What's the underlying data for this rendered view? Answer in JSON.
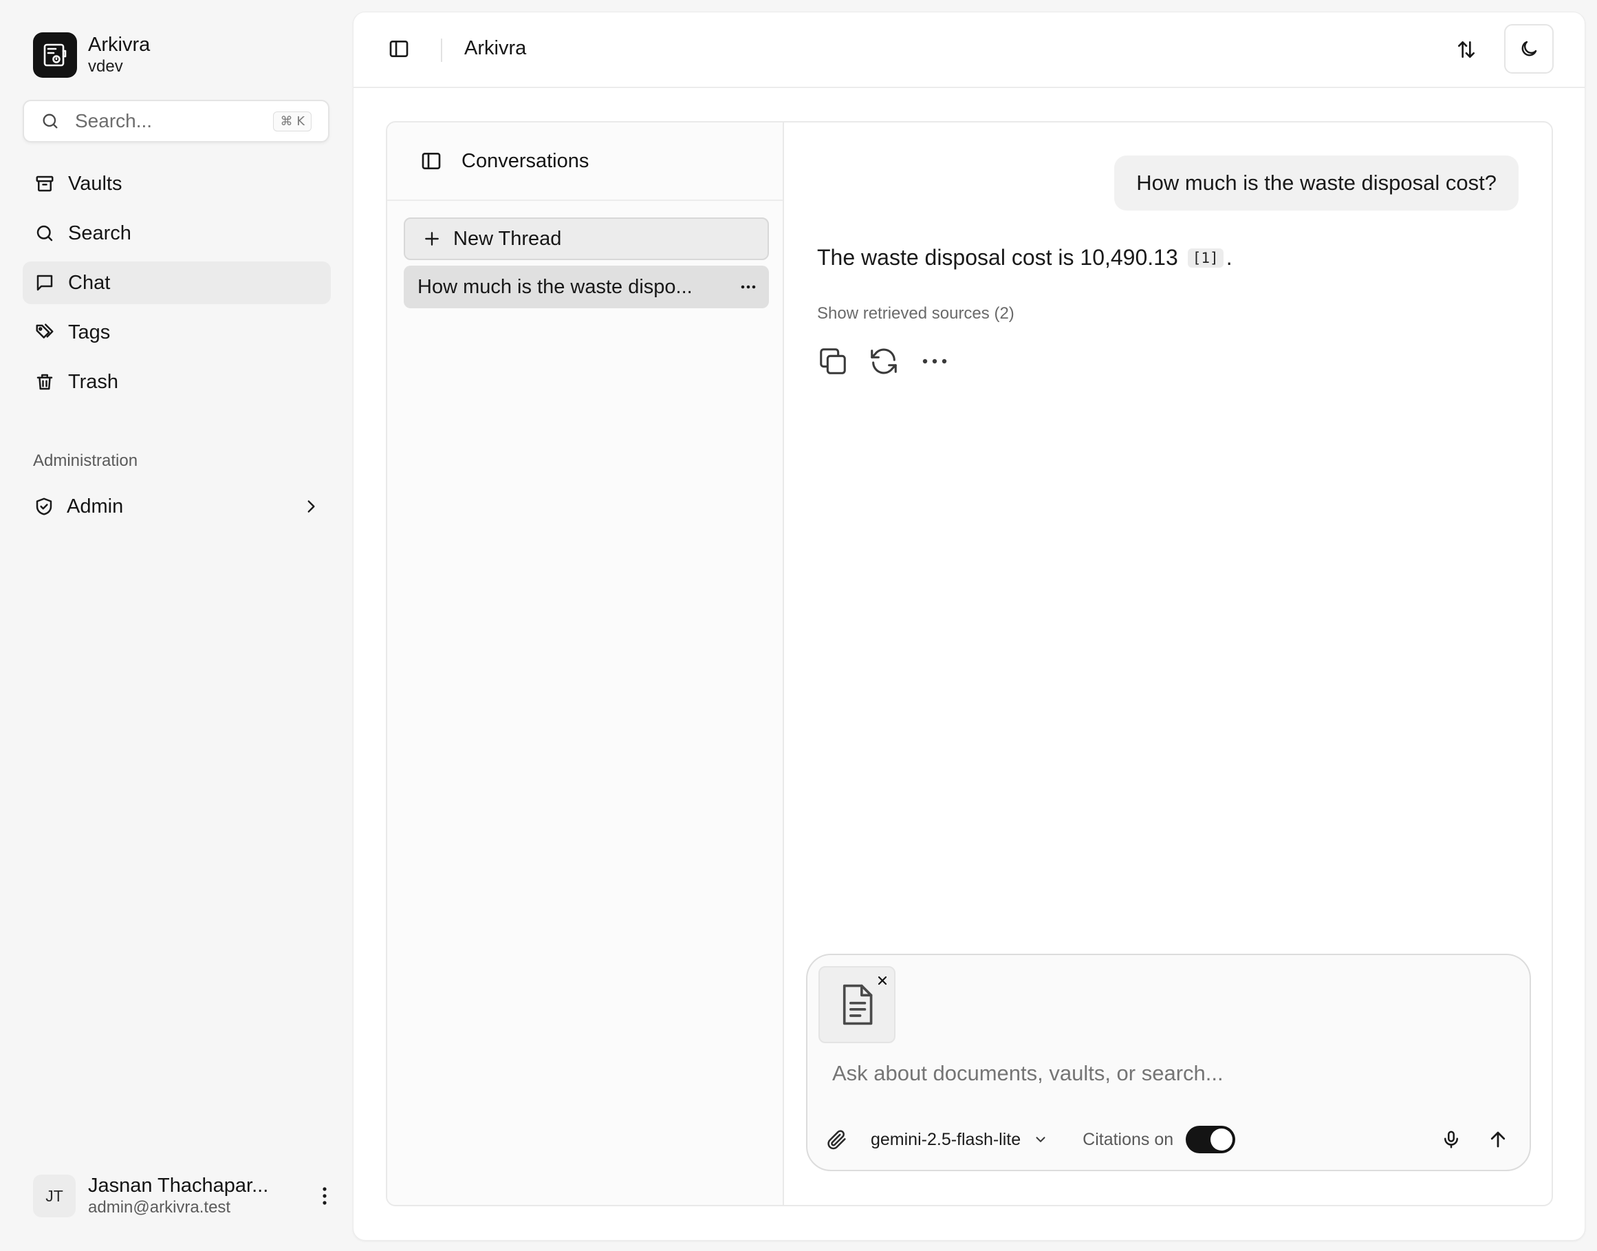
{
  "app": {
    "name": "Arkivra",
    "workspace": "vdev"
  },
  "sidebar": {
    "search_placeholder": "Search...",
    "search_shortcut": "⌘ K",
    "items": [
      {
        "label": "Vaults",
        "icon": "archive-icon"
      },
      {
        "label": "Search",
        "icon": "search-icon"
      },
      {
        "label": "Chat",
        "icon": "message-square-icon",
        "active": true
      },
      {
        "label": "Tags",
        "icon": "tags-icon"
      },
      {
        "label": "Trash",
        "icon": "trash-icon"
      }
    ],
    "admin_section_label": "Administration",
    "admin_label": "Admin"
  },
  "user": {
    "initials": "JT",
    "name": "Jasnan Thachapar...",
    "email": "admin@arkivra.test"
  },
  "header": {
    "title": "Arkivra"
  },
  "conversations": {
    "title": "Conversations",
    "new_thread_label": "New Thread",
    "threads": [
      {
        "title": "How much is the waste dispo...",
        "selected": true
      }
    ]
  },
  "chat": {
    "user_message": "How much is the waste disposal cost?",
    "answer_text": "The waste disposal cost is 10,490.13",
    "citation": "[1]",
    "answer_suffix": ".",
    "sources_toggle": "Show retrieved sources (2)"
  },
  "composer": {
    "placeholder": "Ask about documents, vaults, or search...",
    "model": "gemini-2.5-flash-lite",
    "citations_label": "Citations on",
    "citations_enabled": true
  },
  "colors": {
    "accent": "#141414",
    "sidebar_bg": "#f6f6f6",
    "active_item_bg": "#ebebeb"
  }
}
